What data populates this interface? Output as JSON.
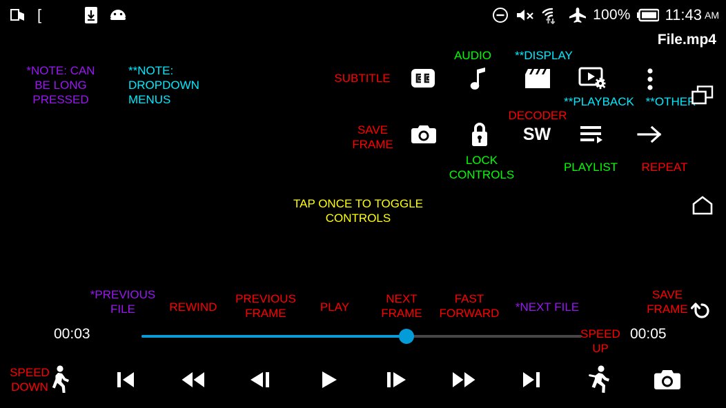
{
  "app": {
    "file_title": "File.mp4"
  },
  "statusbar": {
    "left_icons": [
      {
        "name": "multiwindow-icon"
      },
      {
        "name": "bracket-glyph",
        "glyph": "["
      },
      {
        "name": "download-to-device-icon"
      },
      {
        "name": "android-head-icon"
      }
    ],
    "right": {
      "dnd_icon": "do-not-disturb-icon",
      "volume_icon": "volume-muted-icon",
      "wifi_icon": "wifi-transfer-icon",
      "airplane_icon": "airplane-mode-icon",
      "battery_percent": "100%",
      "battery_icon": "battery-full-icon",
      "time": "11:43",
      "ampm": "AM"
    }
  },
  "notes": {
    "long_press": "*NOTE: CAN\nBE LONG\nPRESSED",
    "dropdown": "**NOTE:\nDROPDOWN\nMENUS",
    "tap_toggle": "TAP ONCE TO TOGGLE\nCONTROLS"
  },
  "top_controls": {
    "subtitle_label": "SUBTITLE",
    "audio_label": "AUDIO",
    "display_label": "**DISPLAY",
    "playback_label": "**PLAYBACK",
    "other_label": "**OTHER",
    "save_frame_label": "SAVE\nFRAME",
    "lock_controls_label": "LOCK\nCONTROLS",
    "decoder_label": "DECODER",
    "decoder_value": "SW",
    "playlist_label": "PLAYLIST",
    "repeat_label": "REPEAT",
    "icons": {
      "subtitle": "closed-caption-icon",
      "audio": "music-note-icon",
      "display": "clapperboard-icon",
      "playback": "video-settings-icon",
      "other": "overflow-menu-icon",
      "save_frame": "camera-icon",
      "lock": "lock-icon",
      "playlist": "playlist-play-icon",
      "repeat": "arrow-right-icon",
      "pip": "picture-in-picture-icon",
      "home": "home-icon",
      "rotate": "rotate-back-icon"
    }
  },
  "bottom_labels": {
    "previous_file": "*PREVIOUS\nFILE",
    "rewind": "REWIND",
    "previous_frame": "PREVIOUS\nFRAME",
    "play": "PLAY",
    "next_frame": "NEXT\nFRAME",
    "fast_forward": "FAST\nFORWARD",
    "next_file": "*NEXT FILE",
    "save_frame": "SAVE\nFRAME",
    "speed_up": "SPEED\nUP",
    "speed_down": "SPEED\nDOWN"
  },
  "seek": {
    "current_time": "00:03",
    "total_time": "00:05",
    "progress_percent": 60,
    "fill_color": "#0a9bd4",
    "track_color": "#464646"
  },
  "transport": {
    "speed_down_icon": "walking-person-icon",
    "skip_previous_icon": "skip-previous-icon",
    "rewind_icon": "fast-rewind-icon",
    "previous_frame_icon": "previous-frame-icon",
    "play_icon": "play-icon",
    "next_frame_icon": "next-frame-icon",
    "fast_forward_icon": "fast-forward-icon",
    "skip_next_icon": "skip-next-icon",
    "speed_up_icon": "running-person-icon",
    "camera_icon": "camera-icon"
  },
  "colors": {
    "red": "#ff0000",
    "green": "#00ff00",
    "cyan": "#00eaff",
    "yellow": "#ffff00",
    "purple": "#9b16f4",
    "accent_blue": "#049cd8"
  }
}
